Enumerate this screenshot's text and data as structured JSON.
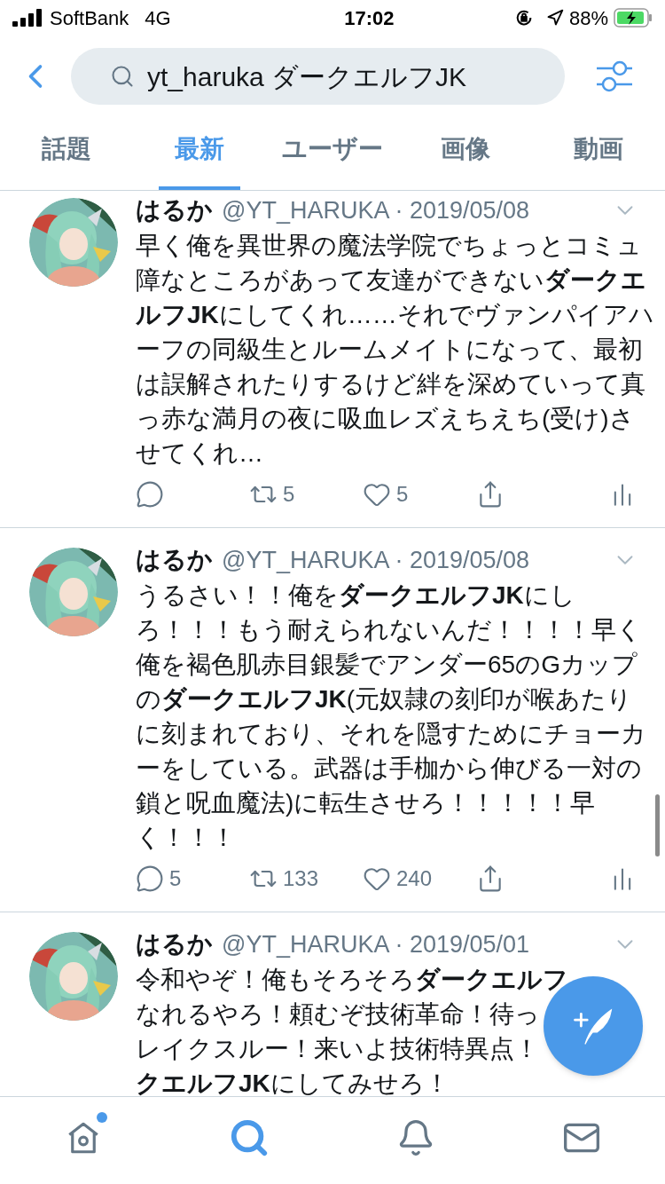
{
  "status_bar": {
    "carrier": "SoftBank",
    "network": "4G",
    "time": "17:02",
    "battery": "88%"
  },
  "search": {
    "value": "yt_haruka ダークエルフJK"
  },
  "tabs": [
    {
      "label": "話題",
      "selected": false
    },
    {
      "label": "最新",
      "selected": true
    },
    {
      "label": "ユーザー",
      "selected": false
    },
    {
      "label": "画像",
      "selected": false
    },
    {
      "label": "動画",
      "selected": false
    }
  ],
  "tweets": [
    {
      "name": "はるか",
      "meta": "@YT_HARUKA · 2019/05/08",
      "lines": [
        "早く俺を異世界の魔法学院でちょっとコミュ障なところがあって友達ができない**ダークエルフJK**にしてくれ……それでヴァンパイアハーフの同級生とルームメイトになって、最初は誤解されたりするけど絆を深めていって真っ赤な満月の夜に吸血レズえちえち(受け)させてくれ…"
      ],
      "actions": {
        "retweet": "5",
        "like": "5"
      }
    },
    {
      "name": "はるか",
      "meta": "@YT_HARUKA · 2019/05/08",
      "lines": [
        "うるさい！！俺を**ダークエルフJK**にしろ！！！もう耐えられないんだ！！！！早く俺を褐色肌赤目銀髪でアンダー65のGカップの**ダークエルフJK**(元奴隷の刻印が喉あたりに刻まれており、それを隠すためにチョーカーをしている。武器は手枷から伸びる一対の鎖と呪血魔法)に転生させろ！！！！！早く！！！"
      ],
      "actions": {
        "reply": "5",
        "retweet": "133",
        "like": "240"
      }
    },
    {
      "name": "はるか",
      "meta": "@YT_HARUKA · 2019/05/01",
      "lines": [
        "令和やぞ！俺もそろそろ**ダークエルフ**",
        "なれるやろ！頼むぞ技術革命！待っ",
        "レイクスルー！来いよ技術特異点！",
        "**クエルフJK**にしてみせろ！"
      ]
    }
  ],
  "nav": [
    {
      "kind": "home",
      "selected": false,
      "dot": true
    },
    {
      "kind": "search",
      "selected": true,
      "dot": false
    },
    {
      "kind": "bell",
      "selected": false,
      "dot": false
    },
    {
      "kind": "mail",
      "selected": false,
      "dot": false
    }
  ]
}
